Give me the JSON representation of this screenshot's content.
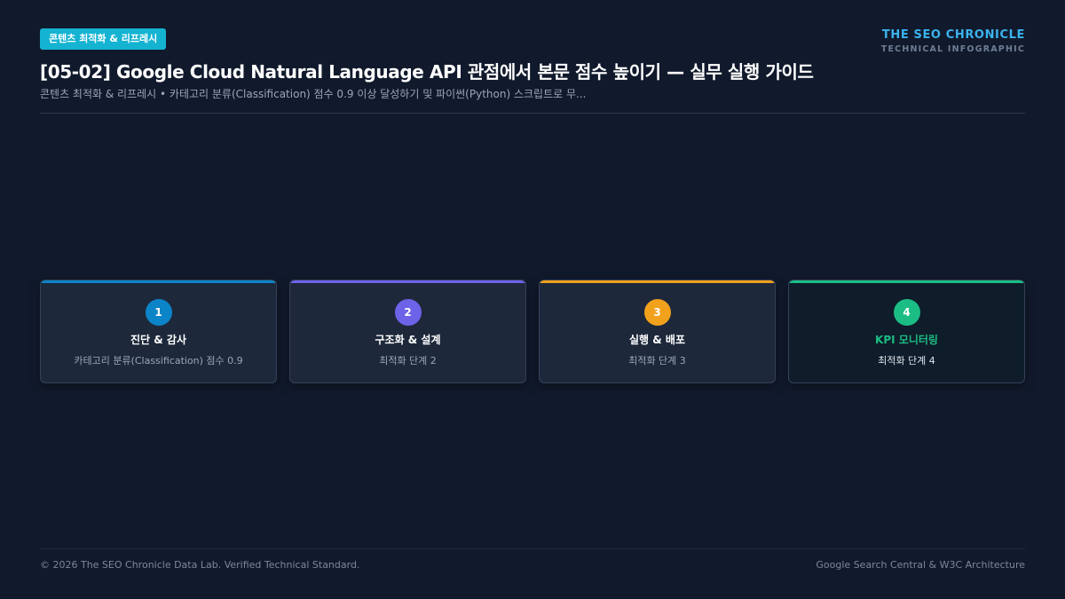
{
  "header": {
    "badge": "콘텐츠 최적화 & 리프레시",
    "title": "[05-02] Google Cloud Natural Language API 관점에서 본문 점수 높이기 — 실무 실행 가이드",
    "subtitle": "콘텐츠 최적화 & 리프레시 • 카테고리 분류(Classification) 점수 0.9 이상 달성하기 및 파이썬(Python) 스크립트로 무...",
    "brand_name": "THE SEO CHRONICLE",
    "brand_tagline": "TECHNICAL INFOGRAPHIC"
  },
  "steps": [
    {
      "number": "1",
      "title": "진단 & 감사",
      "description": "카테고리 분류(Classification) 점수 0.9",
      "color": "#0b84c8"
    },
    {
      "number": "2",
      "title": "구조화 & 설계",
      "description": "최적화 단계 2",
      "color": "#6c63e8"
    },
    {
      "number": "3",
      "title": "실행 & 배포",
      "description": "최적화 단계 3",
      "color": "#f2a11c"
    },
    {
      "number": "4",
      "title": "KPI 모니터링",
      "description": "최적화 단계 4",
      "color": "#1cbd85"
    }
  ],
  "footer": {
    "left": "© 2026 The SEO Chronicle Data Lab. Verified Technical Standard.",
    "right": "Google Search Central & W3C Architecture"
  }
}
